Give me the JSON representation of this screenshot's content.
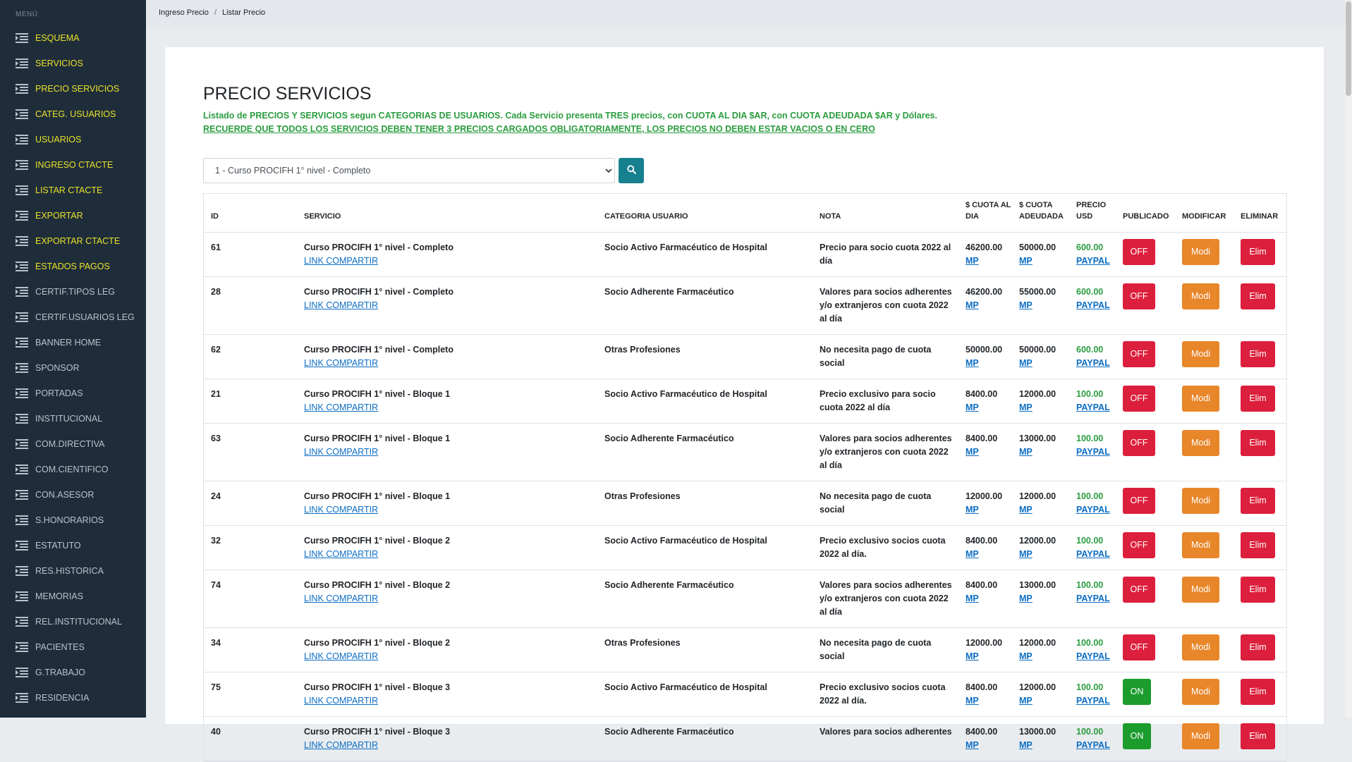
{
  "sidebar": {
    "menu_title": "MENÚ",
    "items": [
      {
        "label": "ESQUEMA",
        "hl": true
      },
      {
        "label": "SERVICIOS",
        "hl": true
      },
      {
        "label": "PRECIO SERVICIOS",
        "hl": true
      },
      {
        "label": "CATEG. USUARIOS",
        "hl": true
      },
      {
        "label": "USUARIOS",
        "hl": true
      },
      {
        "label": "INGRESO CTACTE",
        "hl": true
      },
      {
        "label": "LISTAR CTACTE",
        "hl": true
      },
      {
        "label": "EXPORTAR",
        "hl": true
      },
      {
        "label": "EXPORTAR CTACTE",
        "hl": true
      },
      {
        "label": "ESTADOS PAGOS",
        "hl": true
      },
      {
        "label": "CERTIF.TIPOS LEG",
        "hl": false
      },
      {
        "label": "CERTIF.USUARIOS LEG",
        "hl": false
      },
      {
        "label": "BANNER HOME",
        "hl": false
      },
      {
        "label": "SPONSOR",
        "hl": false
      },
      {
        "label": "PORTADAS",
        "hl": false
      },
      {
        "label": "INSTITUCIONAL",
        "hl": false
      },
      {
        "label": "COM.DIRECTIVA",
        "hl": false
      },
      {
        "label": "COM.CIENTIFICO",
        "hl": false
      },
      {
        "label": "CON.ASESOR",
        "hl": false
      },
      {
        "label": "S.HONORARIOS",
        "hl": false
      },
      {
        "label": "ESTATUTO",
        "hl": false
      },
      {
        "label": "RES.HISTORICA",
        "hl": false
      },
      {
        "label": "MEMORIAS",
        "hl": false
      },
      {
        "label": "REL.INSTITUCIONAL",
        "hl": false
      },
      {
        "label": "PACIENTES",
        "hl": false
      },
      {
        "label": "G.TRABAJO",
        "hl": false
      },
      {
        "label": "RESIDENCIA",
        "hl": false
      }
    ]
  },
  "breadcrumb": {
    "first": "Ingreso Precio",
    "sep": "/",
    "second": "Listar Precio"
  },
  "page": {
    "title": "PRECIO SERVICIOS",
    "desc1": "Listado de PRECIOS Y SERVICIOS segun CATEGORIAS DE USUARIOS. Cada Servicio presenta TRES precios, con CUOTA AL DIA $AR, con CUOTA ADEUDADA $AR y Dólares.",
    "desc2": "RECUERDE QUE TODOS LOS SERVICIOS DEBEN TENER 3 PRECIOS CARGADOS OBLIGATORIAMENTE, LOS PRECIOS NO DEBEN ESTAR VACIOS O EN CERO",
    "select_value": "1 - Curso PROCIFH 1° nivel - Completo"
  },
  "table": {
    "headers": {
      "id": "ID",
      "servicio": "SERVICIO",
      "categoria": "CATEGORIA USUARIO",
      "nota": "NOTA",
      "cuota_dia": "$ CUOTA AL DIA",
      "cuota_adeudada": "$ CUOTA ADEUDADA",
      "precio_usd": "PRECIO USD",
      "publicado": "PUBLICADO",
      "modificar": "MODIFICAR",
      "eliminar": "ELIMINAR"
    },
    "link_compartir": "LINK COMPARTIR",
    "mp": "MP",
    "paypal": "PAYPAL",
    "btn_modi": "Modi",
    "btn_elim": "Elim",
    "rows": [
      {
        "id": "61",
        "servicio": "Curso PROCIFH 1° nivel - Completo",
        "categoria": "Socio Activo Farmacéutico de Hospital",
        "nota": "Precio para socio cuota 2022 al día",
        "cuota_dia": "46200.00",
        "cuota_adeudada": "50000.00",
        "usd": "600.00",
        "publicado": "OFF"
      },
      {
        "id": "28",
        "servicio": "Curso PROCIFH 1° nivel - Completo",
        "categoria": "Socio Adherente Farmacéutico",
        "nota": "Valores para socios adherentes y/o extranjeros con cuota 2022 al día",
        "cuota_dia": "46200.00",
        "cuota_adeudada": "55000.00",
        "usd": "600.00",
        "publicado": "OFF"
      },
      {
        "id": "62",
        "servicio": "Curso PROCIFH 1° nivel - Completo",
        "categoria": "Otras Profesiones",
        "nota": "No necesita pago de cuota social",
        "cuota_dia": "50000.00",
        "cuota_adeudada": "50000.00",
        "usd": "600.00",
        "publicado": "OFF"
      },
      {
        "id": "21",
        "servicio": "Curso PROCIFH 1° nivel - Bloque 1",
        "categoria": "Socio Activo Farmacéutico de Hospital",
        "nota": "Precio exclusivo para socio cuota 2022 al día",
        "cuota_dia": "8400.00",
        "cuota_adeudada": "12000.00",
        "usd": "100.00",
        "publicado": "OFF"
      },
      {
        "id": "63",
        "servicio": "Curso PROCIFH 1° nivel - Bloque 1",
        "categoria": "Socio Adherente Farmacéutico",
        "nota": "Valores para socios adherentes y/o extranjeros con cuota 2022 al día",
        "cuota_dia": "8400.00",
        "cuota_adeudada": "13000.00",
        "usd": "100.00",
        "publicado": "OFF"
      },
      {
        "id": "24",
        "servicio": "Curso PROCIFH 1° nivel - Bloque 1",
        "categoria": "Otras Profesiones",
        "nota": "No necesita pago de cuota social",
        "cuota_dia": "12000.00",
        "cuota_adeudada": "12000.00",
        "usd": "100.00",
        "publicado": "OFF"
      },
      {
        "id": "32",
        "servicio": "Curso PROCIFH 1° nivel - Bloque 2",
        "categoria": "Socio Activo Farmacéutico de Hospital",
        "nota": "Precio exclusivo socios cuota 2022 al día.",
        "cuota_dia": "8400.00",
        "cuota_adeudada": "12000.00",
        "usd": "100.00",
        "publicado": "OFF"
      },
      {
        "id": "74",
        "servicio": "Curso PROCIFH 1° nivel - Bloque 2",
        "categoria": "Socio Adherente Farmacéutico",
        "nota": "Valores para socios adherentes y/o extranjeros con cuota 2022 al día",
        "cuota_dia": "8400.00",
        "cuota_adeudada": "13000.00",
        "usd": "100.00",
        "publicado": "OFF"
      },
      {
        "id": "34",
        "servicio": "Curso PROCIFH 1° nivel - Bloque 2",
        "categoria": "Otras Profesiones",
        "nota": "No necesita pago de cuota social",
        "cuota_dia": "12000.00",
        "cuota_adeudada": "12000.00",
        "usd": "100.00",
        "publicado": "OFF"
      },
      {
        "id": "75",
        "servicio": "Curso PROCIFH 1° nivel - Bloque 3",
        "categoria": "Socio Activo Farmacéutico de Hospital",
        "nota": "Precio exclusivo socios cuota 2022 al día.",
        "cuota_dia": "8400.00",
        "cuota_adeudada": "12000.00",
        "usd": "100.00",
        "publicado": "ON"
      },
      {
        "id": "40",
        "servicio": "Curso PROCIFH 1° nivel - Bloque 3",
        "categoria": "Socio Adherente Farmacéutico",
        "nota": "Valores para socios adherentes",
        "cuota_dia": "8400.00",
        "cuota_adeudada": "13000.00",
        "usd": "100.00",
        "publicado": "ON"
      }
    ]
  }
}
